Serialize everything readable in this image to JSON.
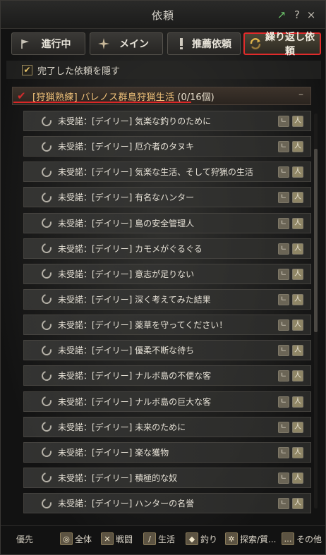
{
  "window": {
    "title": "依頼"
  },
  "titlebar": {
    "external_icon": "↗",
    "help_icon": "?",
    "close_icon": "×"
  },
  "tabs": [
    {
      "label": "進行中",
      "icon": "flag-icon"
    },
    {
      "label": "メイン",
      "icon": "compass-star-icon"
    },
    {
      "label": "推薦依頼",
      "icon": "exclamation-icon"
    },
    {
      "label": "繰り返し依頼",
      "icon": "repeat-arrow-icon"
    }
  ],
  "hide_completed": {
    "label": "完了した依頼を隠す",
    "checked": true
  },
  "group": {
    "title": "[狩猟熟練] バレノス群島狩猟生活",
    "count": "(0/16個)",
    "collapse": "–"
  },
  "quests": [
    "未受諾：[デイリー] 気楽な釣りのために",
    "未受諾：[デイリー] 厄介者のタヌキ",
    "未受諾：[デイリー] 気楽な生活、そして狩猟の生活",
    "未受諾：[デイリー] 有名なハンター",
    "未受諾：[デイリー] 島の安全管理人",
    "未受諾：[デイリー] カモメがぐるぐる",
    "未受諾：[デイリー] 意志が足りない",
    "未受諾：[デイリー] 深く考えてみた結果",
    "未受諾：[デイリー] 薬草を守ってください！",
    "未受諾：[デイリー] 優柔不断な待ち",
    "未受諾：[デイリー] ナルボ島の不便な客",
    "未受諾：[デイリー] ナルボ島の巨大な客",
    "未受諾：[デイリー] 未来のために",
    "未受諾：[デイリー] 楽な獲物",
    "未受諾：[デイリー] 積極的な奴",
    "未受諾：[デイリー] ハンターの名誉"
  ],
  "footer": {
    "priority_label": "優先",
    "filters": [
      {
        "label": "全体",
        "icon": "all-icon"
      },
      {
        "label": "戦闘",
        "icon": "crossed-swords-icon"
      },
      {
        "label": "生活",
        "icon": "life-icon"
      },
      {
        "label": "釣り",
        "icon": "fish-icon"
      },
      {
        "label": "探索/質...",
        "icon": "explore-icon"
      },
      {
        "label": "その他",
        "icon": "more-icon"
      }
    ]
  }
}
